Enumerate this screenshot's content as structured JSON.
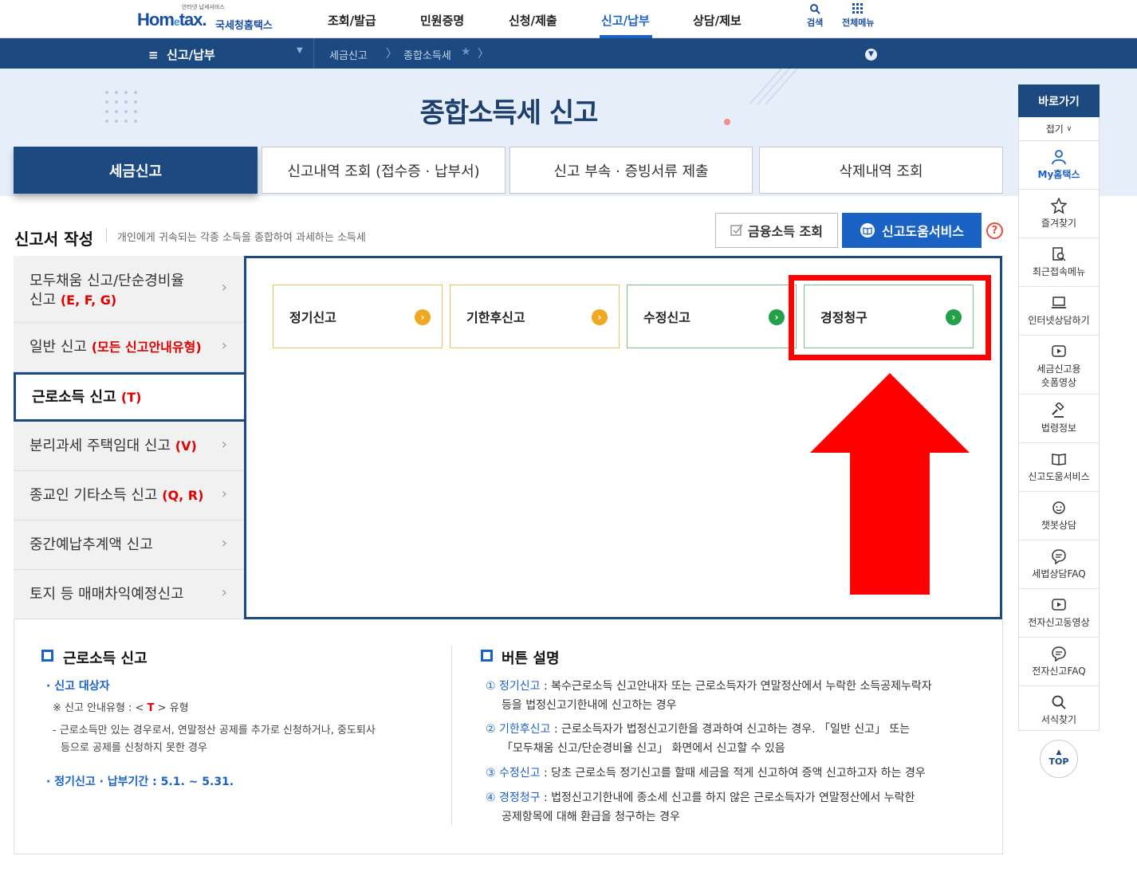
{
  "header": {
    "logo_small": "안터넷 납세서비스",
    "logo_main_a": "Hom",
    "logo_main_e": "e",
    "logo_main_b": "tax.",
    "logo_kor": "국세청홈택스",
    "gnb": [
      "조회/발급",
      "민원증명",
      "신청/제출",
      "신고/납부",
      "상담/제보"
    ],
    "active_gnb": "신고/납부",
    "util_search": "검색",
    "util_allmenu": "전체메뉴"
  },
  "navbar": {
    "menu_label": "신고/납부",
    "crumb1": "세금신고",
    "crumb2": "종합소득세"
  },
  "hero": {
    "title": "종합소득세 신고"
  },
  "tabs": [
    "세금신고",
    "신고내역 조회 (접수증 · 납부서)",
    "신고 부속 · 증빙서류 제출",
    "삭제내역 조회"
  ],
  "section": {
    "title": "신고서 작성",
    "desc": "개인에게 귀속되는 각종 소득을 종합하여 과세하는 소득세",
    "btn_fin": "금융소득 조회",
    "btn_help": "신고도움서비스",
    "help_icon": "?"
  },
  "left_menu": [
    {
      "label": "모두채움 신고/단순경비율",
      "label2": "신고",
      "code": "(E, F, G)"
    },
    {
      "label": "일반 신고",
      "code": "(모든 신고안내유형)"
    },
    {
      "label": "근로소득 신고",
      "code": "(T)"
    },
    {
      "label": "분리과세 주택임대 신고",
      "code": "(V)"
    },
    {
      "label": "종교인 기타소득 신고",
      "code": "(Q, R)"
    },
    {
      "label": "중간예납추계액 신고",
      "code": ""
    },
    {
      "label": "토지 등 매매차익예정신고",
      "code": ""
    }
  ],
  "cards": [
    "정기신고",
    "기한후신고",
    "수정신고",
    "경정청구"
  ],
  "desc_left": {
    "title": "근로소득 신고",
    "target_label": "신고 대상자",
    "type_prefix": "※ 신고 안내유형 : <",
    "type_code": "T",
    "type_suffix": "> 유형",
    "detail1": "- 근로소득만 있는 경우로서, 연말정산 공제를 추가로 신청하거나, 중도퇴사",
    "detail2": "등으로 공제를 신청하지 못한 경우",
    "period": "정기신고 · 납부기간 : 5.1. ~ 5.31."
  },
  "desc_right": {
    "title": "버튼 설명",
    "items": [
      {
        "num": "①",
        "term": "정기신고",
        "text1": " : 복수근로소득 신고안내자 또는 근로소득자가 연말정산에서 누락한 소득공제누락자",
        "text2": "등을 법정신고기한내에 신고하는 경우"
      },
      {
        "num": "②",
        "term": "기한후신고",
        "text1": " : 근로소득자가 법정신고기한을 경과하여 신고하는 경우. 「일반 신고」 또는",
        "text2": "「모두채움 신고/단순경비율 신고」 화면에서 신고할 수 있음"
      },
      {
        "num": "③",
        "term": "수정신고",
        "text1": " : 당초 근로소득 정기신고를 할때 세금을 적게 신고하여 증액 신고하고자 하는 경우",
        "text2": ""
      },
      {
        "num": "④",
        "term": "경정청구",
        "text1": " : 법정신고기한내에 종소세 신고를 하지 않은 근로소득자가 연말정산에서 누락한",
        "text2": "공제항목에 대해 환급을 청구하는 경우"
      }
    ]
  },
  "quick_menu": {
    "head": "바로가기",
    "fold": "접기",
    "items": [
      "My홈택스",
      "즐겨찾기",
      "최근접속메뉴",
      "인터넷상담하기",
      "세금신고용",
      "숏폼영상",
      "법령정보",
      "신고도움서비스",
      "챗봇상담",
      "세법상담FAQ",
      "전자신고동영상",
      "전자신고FAQ",
      "서식찾기"
    ],
    "top": "TOP"
  },
  "colors": {
    "primary": "#1c4a80",
    "accent": "#1a63c4",
    "highlight": "#ff0000",
    "orange": "#f0a820",
    "green": "#22a14a"
  }
}
